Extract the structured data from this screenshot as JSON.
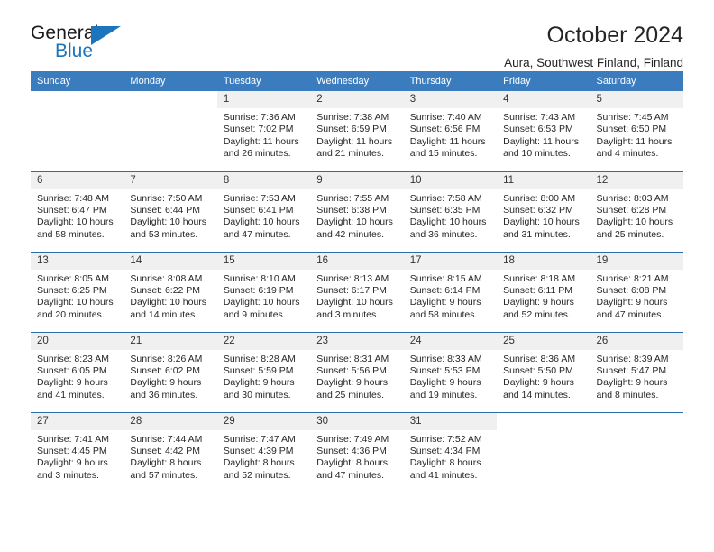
{
  "brand": {
    "name_line1": "General",
    "name_line2": "Blue",
    "accent_color": "#1c75bc",
    "logo_icon": "triangle-icon"
  },
  "header": {
    "title": "October 2024",
    "subtitle": "Aura, Southwest Finland, Finland"
  },
  "calendar": {
    "header_bg": "#3a7cbe",
    "row_border_color": "#2b6cad",
    "daynum_bg": "#f0f0f0",
    "weekday_headers": [
      "Sunday",
      "Monday",
      "Tuesday",
      "Wednesday",
      "Thursday",
      "Friday",
      "Saturday"
    ],
    "weeks": [
      [
        {
          "day": "",
          "lines": []
        },
        {
          "day": "",
          "lines": []
        },
        {
          "day": "1",
          "lines": [
            "Sunrise: 7:36 AM",
            "Sunset: 7:02 PM",
            "Daylight: 11 hours",
            "and 26 minutes."
          ]
        },
        {
          "day": "2",
          "lines": [
            "Sunrise: 7:38 AM",
            "Sunset: 6:59 PM",
            "Daylight: 11 hours",
            "and 21 minutes."
          ]
        },
        {
          "day": "3",
          "lines": [
            "Sunrise: 7:40 AM",
            "Sunset: 6:56 PM",
            "Daylight: 11 hours",
            "and 15 minutes."
          ]
        },
        {
          "day": "4",
          "lines": [
            "Sunrise: 7:43 AM",
            "Sunset: 6:53 PM",
            "Daylight: 11 hours",
            "and 10 minutes."
          ]
        },
        {
          "day": "5",
          "lines": [
            "Sunrise: 7:45 AM",
            "Sunset: 6:50 PM",
            "Daylight: 11 hours",
            "and 4 minutes."
          ]
        }
      ],
      [
        {
          "day": "6",
          "lines": [
            "Sunrise: 7:48 AM",
            "Sunset: 6:47 PM",
            "Daylight: 10 hours",
            "and 58 minutes."
          ]
        },
        {
          "day": "7",
          "lines": [
            "Sunrise: 7:50 AM",
            "Sunset: 6:44 PM",
            "Daylight: 10 hours",
            "and 53 minutes."
          ]
        },
        {
          "day": "8",
          "lines": [
            "Sunrise: 7:53 AM",
            "Sunset: 6:41 PM",
            "Daylight: 10 hours",
            "and 47 minutes."
          ]
        },
        {
          "day": "9",
          "lines": [
            "Sunrise: 7:55 AM",
            "Sunset: 6:38 PM",
            "Daylight: 10 hours",
            "and 42 minutes."
          ]
        },
        {
          "day": "10",
          "lines": [
            "Sunrise: 7:58 AM",
            "Sunset: 6:35 PM",
            "Daylight: 10 hours",
            "and 36 minutes."
          ]
        },
        {
          "day": "11",
          "lines": [
            "Sunrise: 8:00 AM",
            "Sunset: 6:32 PM",
            "Daylight: 10 hours",
            "and 31 minutes."
          ]
        },
        {
          "day": "12",
          "lines": [
            "Sunrise: 8:03 AM",
            "Sunset: 6:28 PM",
            "Daylight: 10 hours",
            "and 25 minutes."
          ]
        }
      ],
      [
        {
          "day": "13",
          "lines": [
            "Sunrise: 8:05 AM",
            "Sunset: 6:25 PM",
            "Daylight: 10 hours",
            "and 20 minutes."
          ]
        },
        {
          "day": "14",
          "lines": [
            "Sunrise: 8:08 AM",
            "Sunset: 6:22 PM",
            "Daylight: 10 hours",
            "and 14 minutes."
          ]
        },
        {
          "day": "15",
          "lines": [
            "Sunrise: 8:10 AM",
            "Sunset: 6:19 PM",
            "Daylight: 10 hours",
            "and 9 minutes."
          ]
        },
        {
          "day": "16",
          "lines": [
            "Sunrise: 8:13 AM",
            "Sunset: 6:17 PM",
            "Daylight: 10 hours",
            "and 3 minutes."
          ]
        },
        {
          "day": "17",
          "lines": [
            "Sunrise: 8:15 AM",
            "Sunset: 6:14 PM",
            "Daylight: 9 hours",
            "and 58 minutes."
          ]
        },
        {
          "day": "18",
          "lines": [
            "Sunrise: 8:18 AM",
            "Sunset: 6:11 PM",
            "Daylight: 9 hours",
            "and 52 minutes."
          ]
        },
        {
          "day": "19",
          "lines": [
            "Sunrise: 8:21 AM",
            "Sunset: 6:08 PM",
            "Daylight: 9 hours",
            "and 47 minutes."
          ]
        }
      ],
      [
        {
          "day": "20",
          "lines": [
            "Sunrise: 8:23 AM",
            "Sunset: 6:05 PM",
            "Daylight: 9 hours",
            "and 41 minutes."
          ]
        },
        {
          "day": "21",
          "lines": [
            "Sunrise: 8:26 AM",
            "Sunset: 6:02 PM",
            "Daylight: 9 hours",
            "and 36 minutes."
          ]
        },
        {
          "day": "22",
          "lines": [
            "Sunrise: 8:28 AM",
            "Sunset: 5:59 PM",
            "Daylight: 9 hours",
            "and 30 minutes."
          ]
        },
        {
          "day": "23",
          "lines": [
            "Sunrise: 8:31 AM",
            "Sunset: 5:56 PM",
            "Daylight: 9 hours",
            "and 25 minutes."
          ]
        },
        {
          "day": "24",
          "lines": [
            "Sunrise: 8:33 AM",
            "Sunset: 5:53 PM",
            "Daylight: 9 hours",
            "and 19 minutes."
          ]
        },
        {
          "day": "25",
          "lines": [
            "Sunrise: 8:36 AM",
            "Sunset: 5:50 PM",
            "Daylight: 9 hours",
            "and 14 minutes."
          ]
        },
        {
          "day": "26",
          "lines": [
            "Sunrise: 8:39 AM",
            "Sunset: 5:47 PM",
            "Daylight: 9 hours",
            "and 8 minutes."
          ]
        }
      ],
      [
        {
          "day": "27",
          "lines": [
            "Sunrise: 7:41 AM",
            "Sunset: 4:45 PM",
            "Daylight: 9 hours",
            "and 3 minutes."
          ]
        },
        {
          "day": "28",
          "lines": [
            "Sunrise: 7:44 AM",
            "Sunset: 4:42 PM",
            "Daylight: 8 hours",
            "and 57 minutes."
          ]
        },
        {
          "day": "29",
          "lines": [
            "Sunrise: 7:47 AM",
            "Sunset: 4:39 PM",
            "Daylight: 8 hours",
            "and 52 minutes."
          ]
        },
        {
          "day": "30",
          "lines": [
            "Sunrise: 7:49 AM",
            "Sunset: 4:36 PM",
            "Daylight: 8 hours",
            "and 47 minutes."
          ]
        },
        {
          "day": "31",
          "lines": [
            "Sunrise: 7:52 AM",
            "Sunset: 4:34 PM",
            "Daylight: 8 hours",
            "and 41 minutes."
          ]
        },
        {
          "day": "",
          "lines": []
        },
        {
          "day": "",
          "lines": []
        }
      ]
    ]
  }
}
